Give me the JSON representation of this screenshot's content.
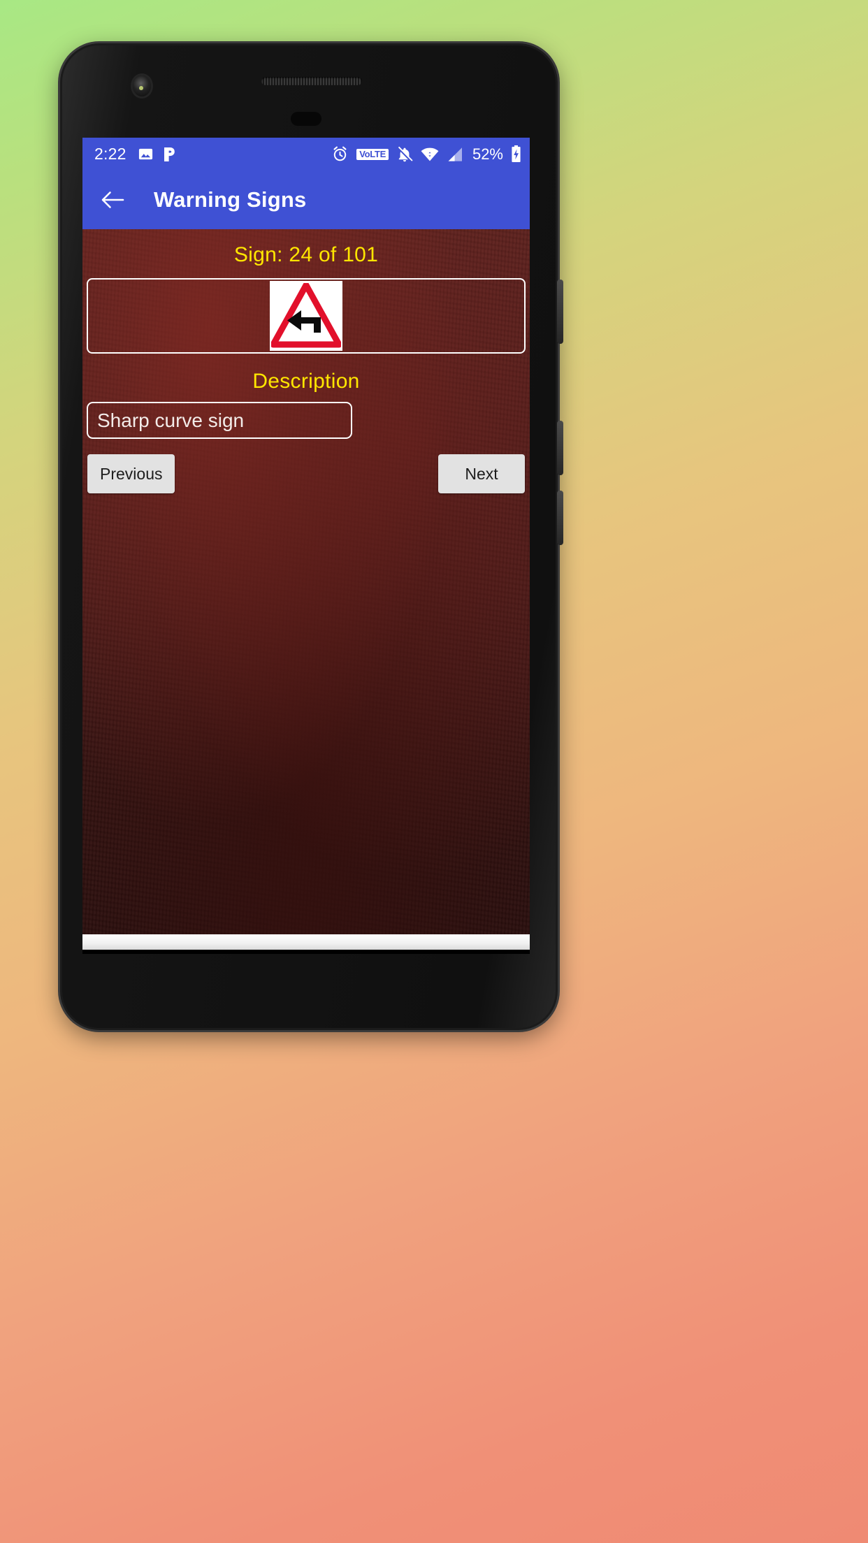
{
  "status_bar": {
    "time": "2:22",
    "battery_percent": "52%",
    "volte_label": "VoLTE",
    "icons": [
      "photo-icon",
      "pandora-p-icon",
      "alarm-clock-icon",
      "volte-icon",
      "notifications-muted-icon",
      "wifi-icon",
      "cell-signal-icon",
      "battery-charging-icon"
    ],
    "background_color": "#3f51d4"
  },
  "app_bar": {
    "title": "Warning Signs",
    "back_icon": "back-arrow-icon",
    "background_color": "#3f51d4",
    "text_color": "#ffffff"
  },
  "content": {
    "counter": "Sign: 24 of 101",
    "counter_color": "#ffe600",
    "sign": {
      "name": "sharp-left-curve-warning-sign",
      "shape": "triangle",
      "border_color": "#e2102b",
      "symbol_color": "#000000",
      "background_color": "#ffffff"
    },
    "description_label": "Description",
    "description_label_color": "#ffe600",
    "description_value": "Sharp curve sign",
    "description_placeholder": "Description",
    "description_text_color": "#f3ece9",
    "buttons": {
      "previous": "Previous",
      "next": "Next"
    },
    "background_color": "#4e1f1c"
  },
  "device": {
    "frame_color": "#1b1b1b",
    "camera_icon": "front-camera-icon",
    "earpiece_icon": "earpiece-speaker-icon",
    "sensor_icon": "proximity-sensor-icon"
  },
  "wallpaper": {
    "gradient_start": "#a8e884",
    "gradient_end": "#ef8a73"
  }
}
